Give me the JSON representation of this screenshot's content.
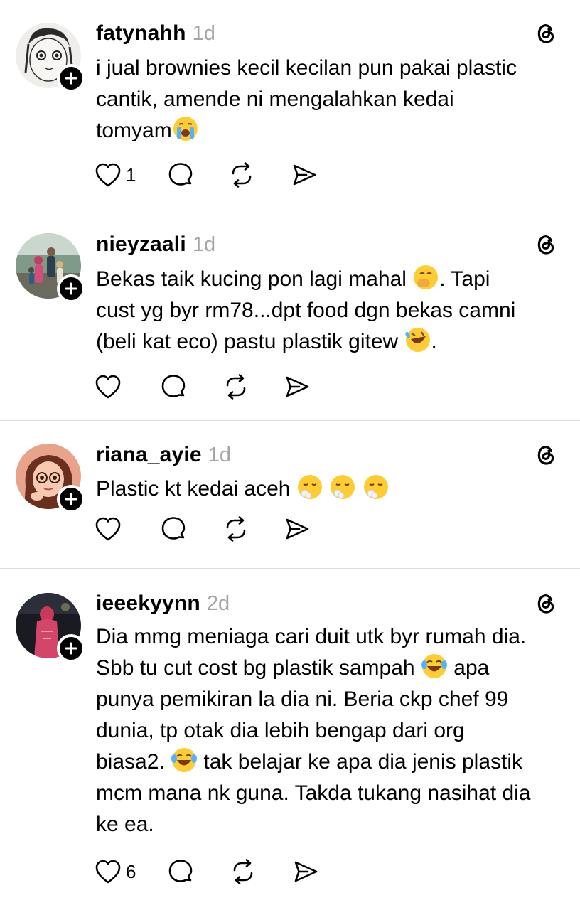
{
  "posts": [
    {
      "username": "fatynahh",
      "time": "1d",
      "text_parts": [
        "i jual brownies kecil kecilan pun pakai plastic\ncantik, amende ni mengalahkan kedai\ntomyam"
      ],
      "emojis": [
        "loudly-crying-face"
      ],
      "likes": "1"
    },
    {
      "username": "nieyzaali",
      "time": "1d",
      "text_parts": [
        "Bekas taik kucing pon lagi mahal ",
        ". Tapi\ncust yg byr rm78...dpt food dgn bekas camni\n(beli kat eco) pastu plastik gitew ",
        "."
      ],
      "emojis": [
        "face-with-hand-over-mouth",
        "rolling-on-the-floor-laughing"
      ],
      "likes": ""
    },
    {
      "username": "riana_ayie",
      "time": "1d",
      "text_parts": [
        "Plastic kt kedai aceh "
      ],
      "emojis": [
        "face-exhaling",
        "face-exhaling",
        "face-exhaling"
      ],
      "likes": ""
    },
    {
      "username": "ieeekyynn",
      "time": "2d",
      "text_parts": [
        "Dia mmg meniaga cari duit utk byr rumah dia.\nSbb tu cut cost bg plastik sampah ",
        " apa\npunya pemikiran la dia ni. Beria ckp chef 99\ndunia, tp otak dia lebih bengap dari org\nbiasa2. ",
        " tak belajar ke apa dia jenis plastik\nmcm mana nk guna. Takda tukang nasihat dia\nke ea."
      ],
      "emojis": [
        "face-with-tears-of-joy",
        "face-with-tears-of-joy"
      ],
      "likes": "6"
    }
  ],
  "icons": {
    "like": "heart-icon",
    "reply": "comment-icon",
    "repost": "repost-icon",
    "share": "send-icon",
    "brand": "threads-logo-icon",
    "follow": "plus-icon"
  },
  "colors": {
    "text": "#000000",
    "timestamp": "#a5a5a5",
    "divider": "#dcdcdc",
    "background": "#ffffff"
  }
}
